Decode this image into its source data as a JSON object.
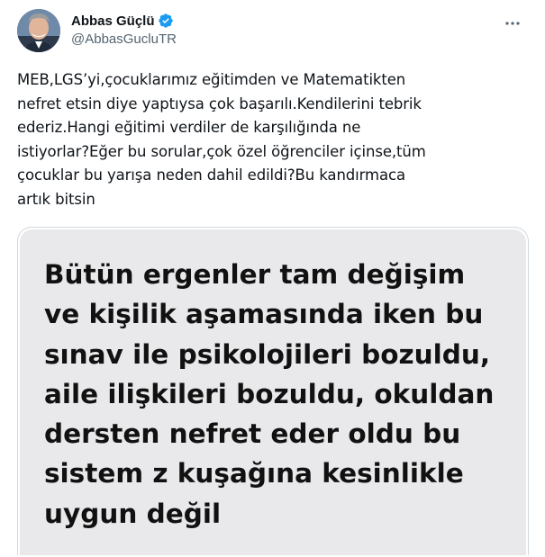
{
  "author": {
    "display_name": "Abbas Güçlü",
    "handle": "@AbbasGucluTR",
    "verified": true,
    "avatar_icon": "profile-photo-icon"
  },
  "tweet": {
    "text": "MEB,LGS’yi,çocuklarımız eğitimden ve Matematikten\nnefret etsin diye yaptıysa çok başarılı.Kendilerini tebrik\nederiz.Hangi eğitimi verdiler de karşılığında ne\nistiyorlar?Eğer bu sorular,çok özel öğrenciler içinse,tüm\nçocuklar bu yarışa neden dahil edildi?Bu kandırmaca\nartık bitsin"
  },
  "media": {
    "image_text": "Bütün ergenler tam değişim\nve kişilik aşamasında iken bu\nsınav ile psikolojileri bozuldu,\naile ilişkileri bozuldu, okuldan\ndersten nefret eder oldu bu\nsistem z kuşağına kesinlikle\nuygun değil"
  },
  "icons": {
    "verified": "verified-badge-icon",
    "more": "more-options-icon"
  },
  "colors": {
    "verified_blue": "#1d9bf0",
    "text_primary": "#0f1419",
    "text_secondary": "#536471",
    "bubble_gray": "#e9e9eb"
  }
}
